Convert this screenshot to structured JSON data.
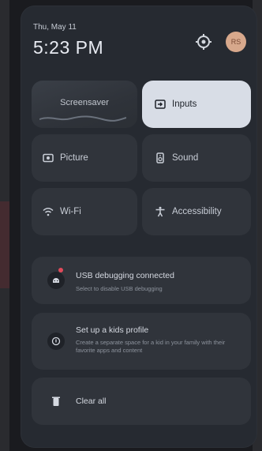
{
  "header": {
    "date": "Thu, May 11",
    "time": "5:23 PM",
    "avatar_initials": "RS"
  },
  "tiles": {
    "screensaver": "Screensaver",
    "inputs": "Inputs",
    "picture": "Picture",
    "sound": "Sound",
    "wifi": "Wi-Fi",
    "accessibility": "Accessibility"
  },
  "notifications": [
    {
      "title": "USB debugging connected",
      "subtitle": "Select to disable USB debugging"
    },
    {
      "title": "Set up a kids profile",
      "subtitle": "Create a separate space for a kid in your family with their favorite apps and content"
    },
    {
      "title": "Clear all",
      "subtitle": ""
    }
  ],
  "icons": {
    "settings": "gear-icon",
    "inputs": "input-icon",
    "picture": "picture-icon",
    "sound": "speaker-icon",
    "wifi": "wifi-icon",
    "accessibility": "accessibility-icon",
    "usb": "android-debug-icon",
    "kids": "kids-profile-icon",
    "clear": "trash-icon"
  },
  "colors": {
    "panel": "#262a31",
    "tile": "#30343b",
    "selected_tile": "#d8dde6",
    "alert_dot": "#e04a5a"
  }
}
